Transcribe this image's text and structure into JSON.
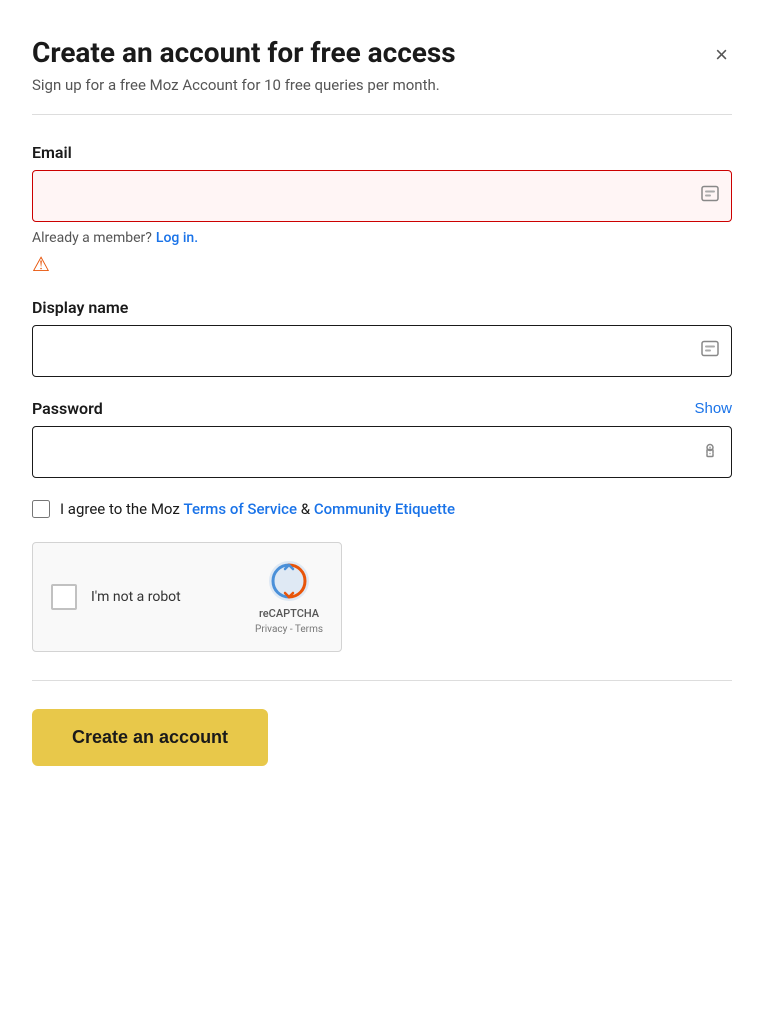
{
  "modal": {
    "title": "Create an account for free access",
    "subtitle": "Sign up for a free Moz Account for 10 free queries per month.",
    "close_label": "×"
  },
  "form": {
    "email": {
      "label": "Email",
      "placeholder": "",
      "value": ""
    },
    "already_member": {
      "text": "Already a member?",
      "link_text": "Log in."
    },
    "display_name": {
      "label": "Display name",
      "placeholder": "",
      "value": ""
    },
    "password": {
      "label": "Password",
      "show_label": "Show",
      "placeholder": "",
      "value": ""
    },
    "agree": {
      "prefix": "I agree to the Moz ",
      "tos_link": "Terms of Service",
      "middle": " & ",
      "ce_link": "Community Etiquette"
    },
    "recaptcha": {
      "label": "I'm not a robot",
      "brand": "reCAPTCHA",
      "privacy_link": "Privacy",
      "separator": " - ",
      "terms_link": "Terms"
    },
    "submit_label": "Create an account"
  }
}
